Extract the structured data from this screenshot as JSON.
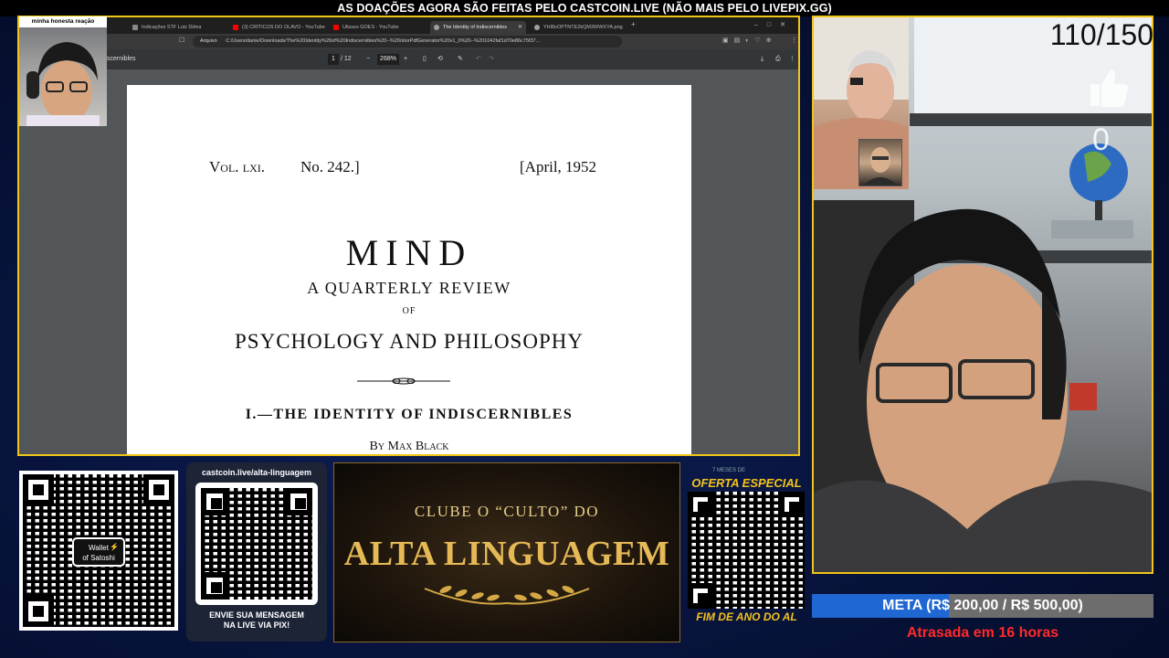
{
  "top_banner": "AS DOAÇÕES AGORA SÃO FEITAS PELO CASTCOIN.LIVE (NÃO MAIS PELO LIVEPIX.GG)",
  "small_cam": {
    "label": "minha honesta reação"
  },
  "browser": {
    "tabs": [
      {
        "label": "Indicações STF Luiz Dilma",
        "icon_color": "#888888",
        "active": false
      },
      {
        "label": "(3) CRÍTICOS DO OLAVO - YouTube",
        "icon_color": "#ff0000",
        "active": false
      },
      {
        "label": "Ulisses GOES - YouTube",
        "icon_color": "#ff0000",
        "active": false
      },
      {
        "label": "The Identity of Indiscernibles",
        "icon_color": "#9e9e9e",
        "active": true
      },
      {
        "label": "YHl8oOPTNTE2kQM3WWXYA.png",
        "icon_color": "#9e9e9e",
        "active": false
      }
    ],
    "address": {
      "scheme_label": "Arquivo",
      "url": "C:/Users/danie/Downloads/The%20Identity%20of%20Indiscernibles%20--%20/storPdfGenerator%20v1_0%20--%201042faf1d70e86c75f37..."
    },
    "pdf_toolbar": {
      "doc_title": "scernibles",
      "current_page": "1",
      "total_pages": "/ 12",
      "zoom": "268%",
      "zoom_minus": "−",
      "zoom_plus": "+"
    }
  },
  "pdf_page": {
    "vol": "Vol. lxi.",
    "no": "No. 242.]",
    "date": "[April, 1952",
    "journal": "MIND",
    "subtitle": "A QUARTERLY REVIEW",
    "of": "OF",
    "field": "PSYCHOLOGY AND PHILOSOPHY",
    "article": "I.—THE IDENTITY OF INDISCERNIBLES",
    "author": "By Max Black"
  },
  "main_cam": {
    "like_counter": "110/150",
    "like_count_overlay": "0"
  },
  "qr_satoshi": {
    "badge_line1": "Wallet",
    "badge_line2": "of Satoshi"
  },
  "castcoin": {
    "url": "castcoin.live/alta-linguagem",
    "message_line1": "ENVIE SUA MENSAGEM",
    "message_line2": "NA LIVE VIA PIX!"
  },
  "club_banner": {
    "line1": "CLUBE O “CULTO” DO",
    "line2": "ALTA LINGUAGEM"
  },
  "oferta": {
    "small_text": "7 MESES DE",
    "title": "OFERTA ESPECIAL",
    "footer": "FIM DE ANO DO AL"
  },
  "goal": {
    "text": "META (R$ 200,00 / R$ 500,00)",
    "current": 200,
    "target": 500,
    "status": "Atrasada em 16 horas"
  },
  "colors": {
    "frame_gold": "#f0c419",
    "goal_fill": "#1f67d2",
    "goal_status": "#ff2a2a",
    "offer_yellow": "#f2c31b",
    "club_gold": "#e5b956"
  }
}
